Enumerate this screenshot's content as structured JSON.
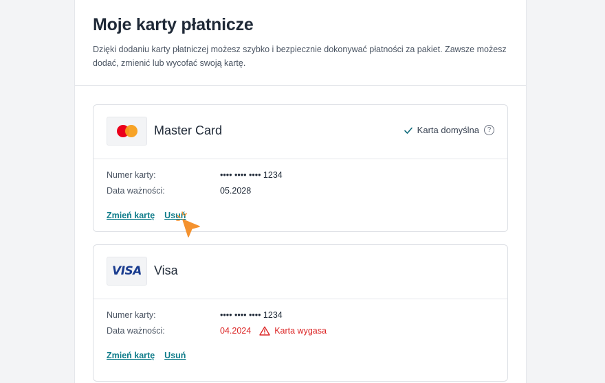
{
  "page": {
    "title": "Moje karty płatnicze",
    "description": "Dzięki dodaniu karty płatniczej możesz szybko i bezpiecznie dokonywać płatności za pakiet. Zawsze możesz dodać, zmienić lub wycofać swoją kartę."
  },
  "cards": [
    {
      "logo_icon": "mastercard-logo",
      "name": "Master Card",
      "default_label": "Karta domyślna",
      "number_label": "Numer karty:",
      "number": "•••• •••• •••• 1234",
      "expiry_label": "Data ważności:",
      "expiry": "05.2028",
      "change_label": "Zmień kartę",
      "remove_label": "Usuń"
    },
    {
      "logo_text": "VISA",
      "name": "Visa",
      "number_label": "Numer karty:",
      "number": "•••• •••• •••• 1234",
      "expiry_label": "Data ważności:",
      "expiry": "04.2024",
      "expiry_warning": "Karta wygasa",
      "change_label": "Zmień kartę",
      "remove_label": "Usuń"
    }
  ],
  "colors": {
    "link": "#0f7c8a",
    "expired": "#dc2626",
    "check": "#0f6a7a",
    "cursor": "#f4922f"
  },
  "icons": [
    "check-icon",
    "help-circle-icon",
    "warning-triangle-icon",
    "mouse-pointer-icon"
  ]
}
